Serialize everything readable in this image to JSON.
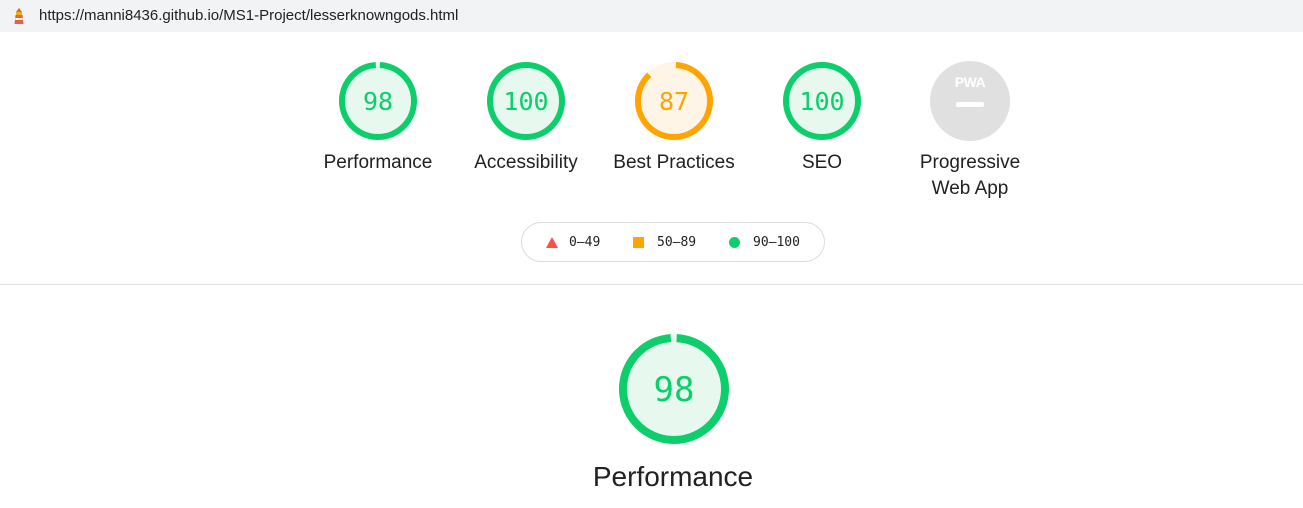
{
  "address_bar": {
    "url": "https://manni8436.github.io/MS1-Project/lesserknowngods.html",
    "favicon": "lighthouse-icon"
  },
  "gauges": [
    {
      "label": "Performance",
      "score": "98",
      "status": "pass"
    },
    {
      "label": "Accessibility",
      "score": "100",
      "status": "pass"
    },
    {
      "label": "Best Practices",
      "score": "87",
      "status": "average"
    },
    {
      "label": "SEO",
      "score": "100",
      "status": "pass"
    },
    {
      "label_line1": "Progressive",
      "label_line2": "Web App",
      "badge": "PWA",
      "status": "not-applicable"
    }
  ],
  "legend": {
    "fail_range": "0–49",
    "average_range": "50–89",
    "pass_range": "90–100"
  },
  "main_gauge": {
    "label": "Performance",
    "score": "98"
  },
  "colors": {
    "pass": "#0cce6b",
    "pass_fill": "#e7f9ee",
    "average": "#ffa400",
    "average_fill": "#fff5e6",
    "fail": "#ff4e42",
    "na": "#e0e0e0"
  }
}
